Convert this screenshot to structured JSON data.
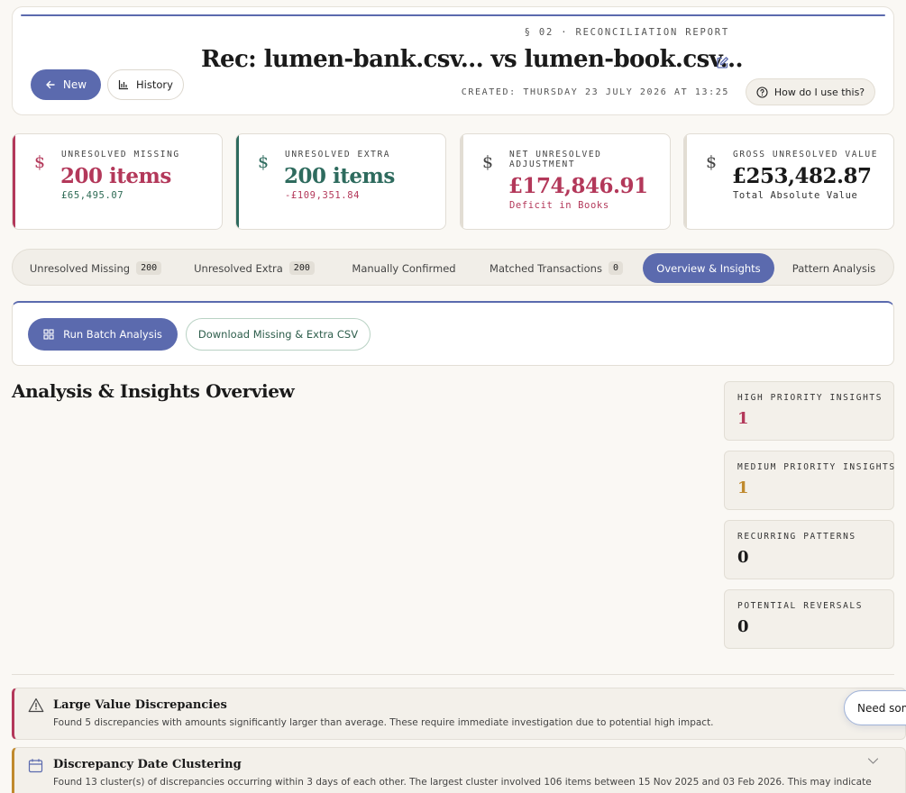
{
  "header": {
    "new_label": "New",
    "history_label": "History",
    "eyebrow": "§ 02 · RECONCILIATION REPORT",
    "title": "Rec: lumen-bank.csv... vs lumen-book.csv...",
    "created": "CREATED: THURSDAY 23 JULY 2026 AT 13:25",
    "help_label": "How do I use this?"
  },
  "stats": [
    {
      "label": "UNRESOLVED MISSING",
      "value": "200 items",
      "sub": "£65,495.07",
      "accent": "#b3385a",
      "value_color": "#b3385a",
      "sub_color": "#2e6b55"
    },
    {
      "label": "UNRESOLVED EXTRA",
      "value": "200 items",
      "sub": "-£109,351.84",
      "accent": "#2e6b5e",
      "value_color": "#2e6b5e",
      "sub_color": "#b3385a"
    },
    {
      "label": "NET UNRESOLVED ADJUSTMENT",
      "value": "£174,846.91",
      "sub": "Deficit in Books",
      "accent": "#e2ddd3",
      "value_color": "#b3385a",
      "sub_color": "#b3385a"
    },
    {
      "label": "GROSS UNRESOLVED VALUE",
      "value": "£253,482.87",
      "sub": "Total Absolute Value",
      "accent": "#e2ddd3",
      "value_color": "#1a1a1a",
      "sub_color": "#333333"
    }
  ],
  "tabs": [
    {
      "label": "Unresolved Missing",
      "count": "200"
    },
    {
      "label": "Unresolved Extra",
      "count": "200"
    },
    {
      "label": "Manually Confirmed",
      "count": ""
    },
    {
      "label": "Matched Transactions",
      "count": "0"
    },
    {
      "label": "Overview & Insights",
      "count": ""
    },
    {
      "label": "Pattern Analysis",
      "count": ""
    }
  ],
  "active_tab": "Overview & Insights",
  "actions": {
    "batch_label": "Run Batch Analysis",
    "download_label": "Download Missing & Extra CSV"
  },
  "overview": {
    "title": "Analysis & Insights Overview",
    "insights": [
      {
        "label": "HIGH PRIORITY INSIGHTS",
        "value": "1",
        "color": "#b3385a"
      },
      {
        "label": "MEDIUM PRIORITY INSIGHTS",
        "value": "1",
        "color": "#c08a2e"
      },
      {
        "label": "RECURRING PATTERNS",
        "value": "0",
        "color": "#1a1a1a"
      },
      {
        "label": "POTENTIAL REVERSALS",
        "value": "0",
        "color": "#1a1a1a"
      }
    ]
  },
  "alerts": [
    {
      "title": "Large Value Discrepancies",
      "text": "Found 5 discrepancies with amounts significantly larger than average. These require immediate investigation due to potential high impact.",
      "icon": "warning-icon",
      "color": "#b3385a"
    },
    {
      "title": "Discrepancy Date Clustering",
      "text": "Found 13 cluster(s) of discrepancies occurring within 3 days of each other. The largest cluster involved 106 items between 15 Nov 2025 and 03 Feb 2026. This may indicate",
      "icon": "calendar-icon",
      "color": "#c08a2e"
    }
  ],
  "chat": {
    "label": "Need some help?"
  }
}
